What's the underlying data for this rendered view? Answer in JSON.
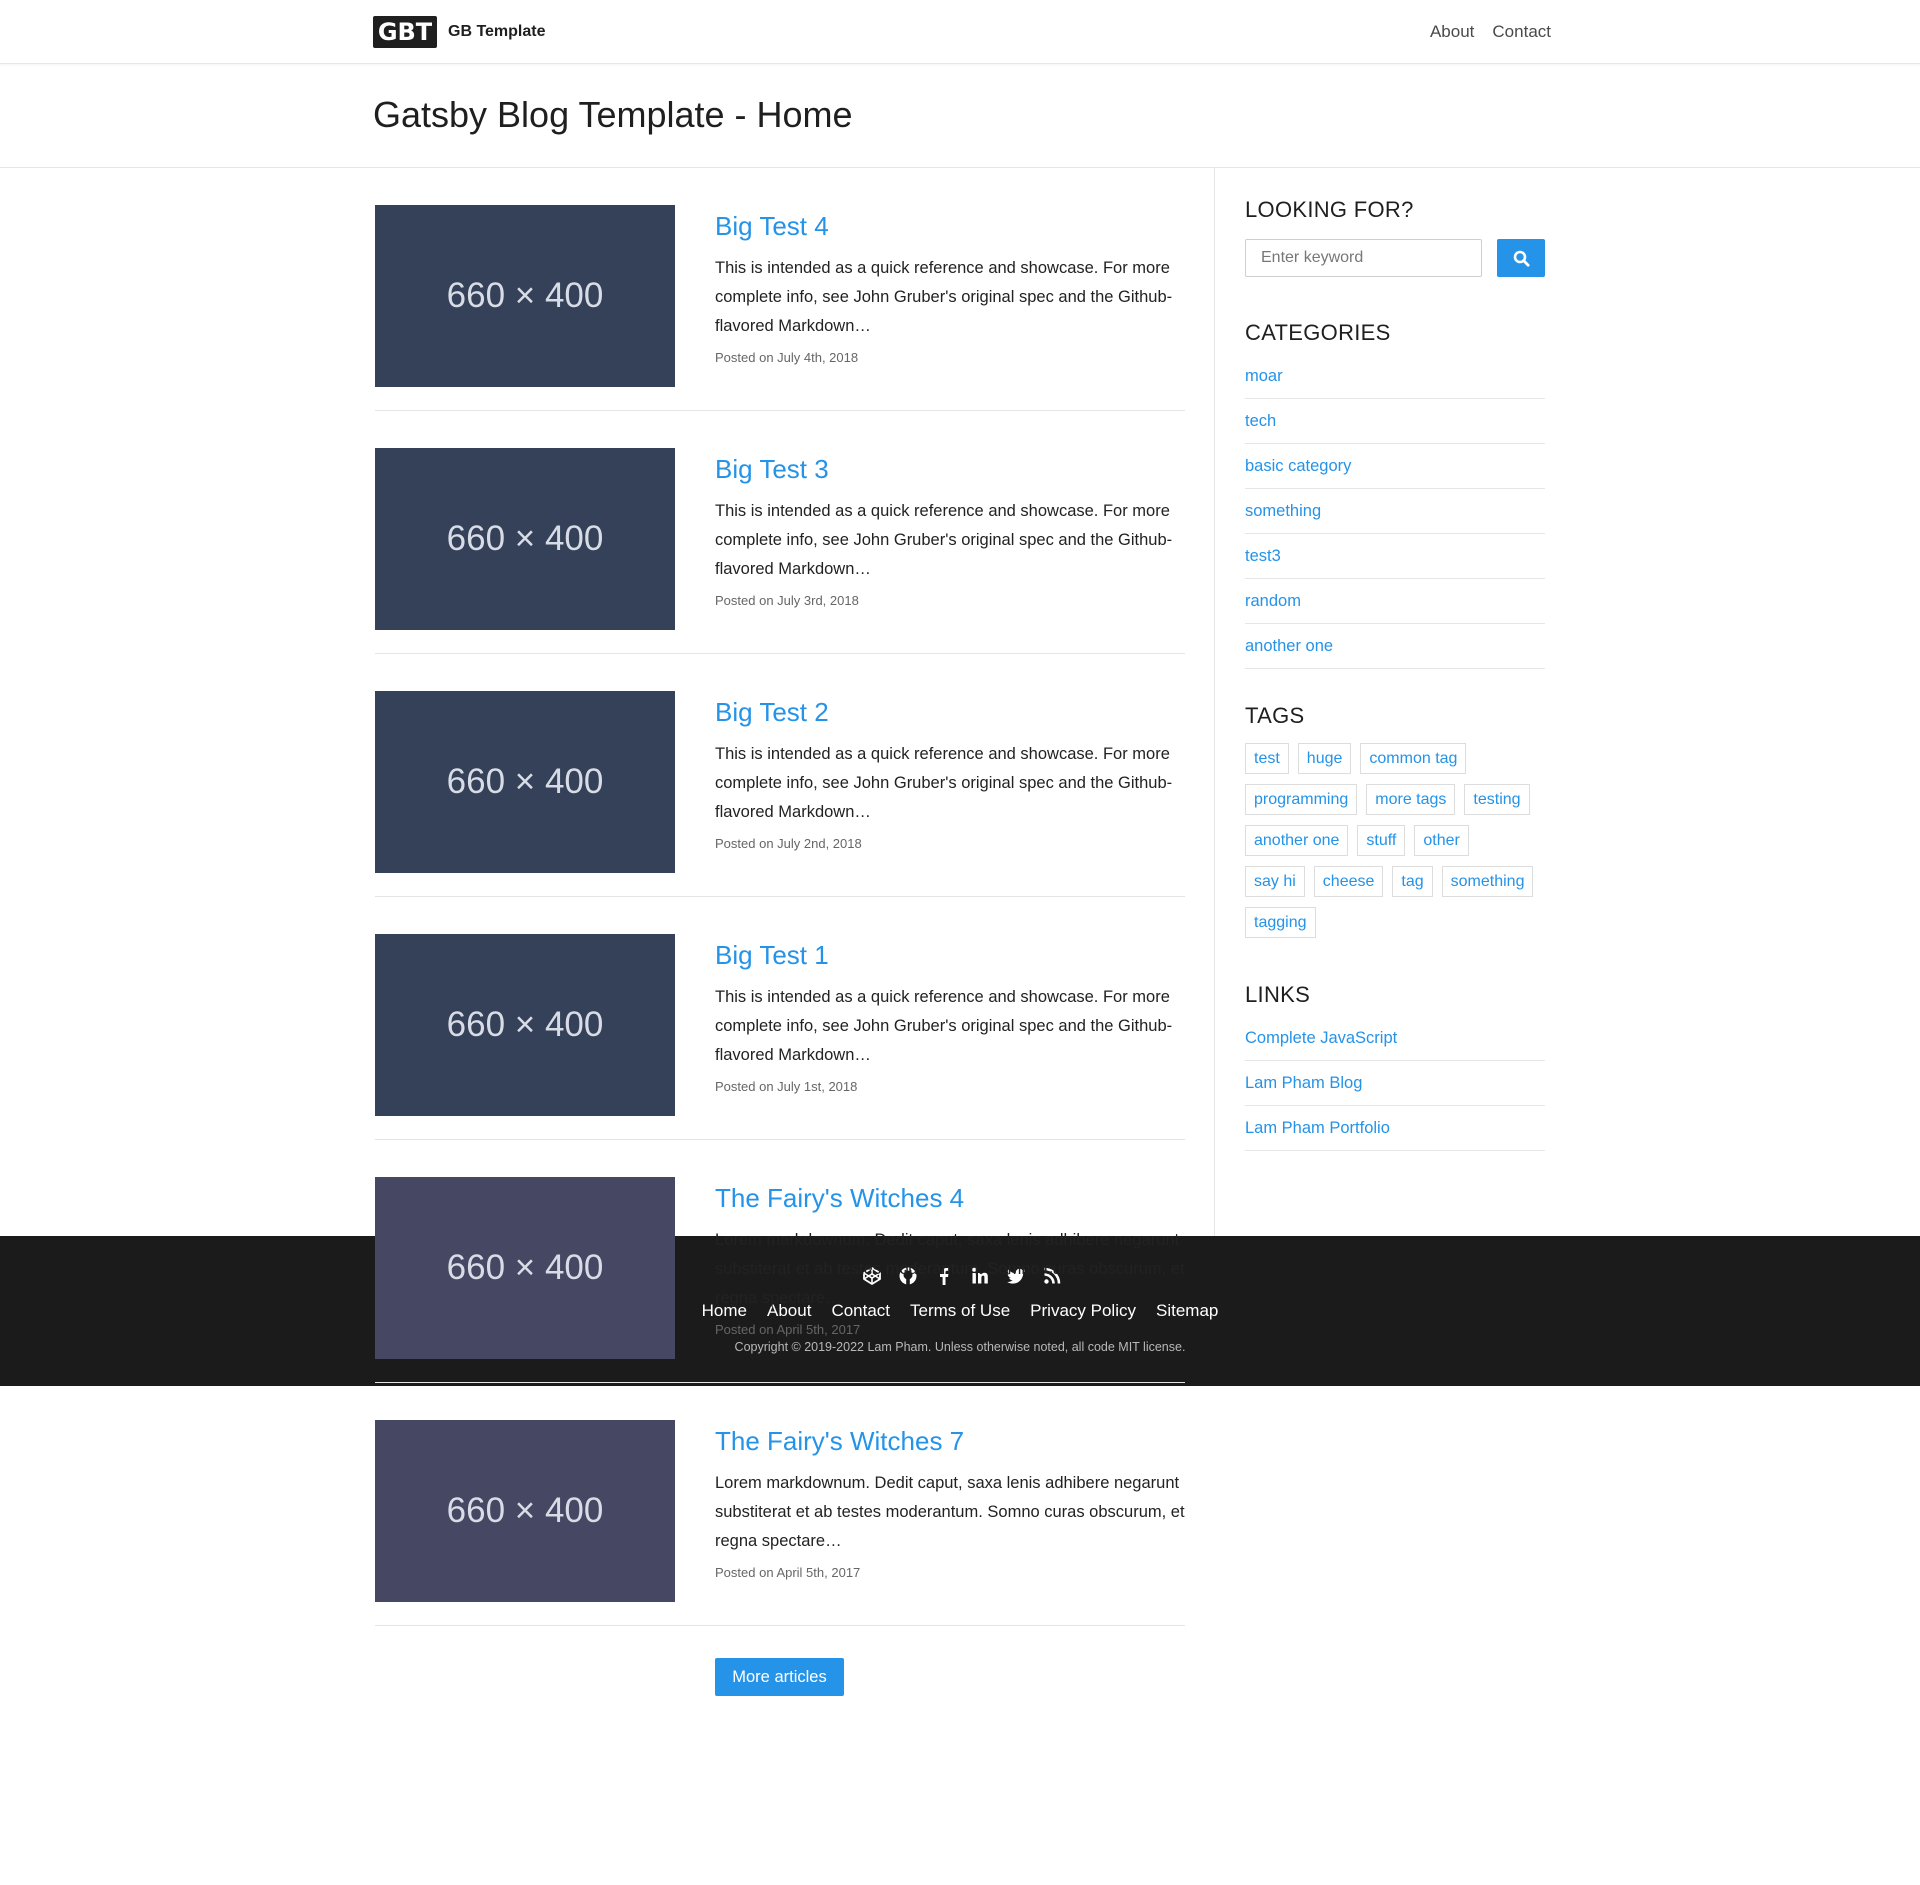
{
  "nav": {
    "logo_text": "GBT",
    "brand": "GB Template",
    "links": [
      "About",
      "Contact"
    ]
  },
  "header": {
    "title": "Gatsby Blog Template - Home"
  },
  "posts": [
    {
      "thumb_label": "660 × 400",
      "thumb_color": "#344158",
      "title": "Big Test 4",
      "excerpt": "This is intended as a quick reference and showcase. For more complete info, see John Gruber's original spec and the Github-flavored Markdown…",
      "date": "Posted on July 4th, 2018"
    },
    {
      "thumb_label": "660 × 400",
      "thumb_color": "#344158",
      "title": "Big Test 3",
      "excerpt": "This is intended as a quick reference and showcase. For more complete info, see John Gruber's original spec and the Github-flavored Markdown…",
      "date": "Posted on July 3rd, 2018"
    },
    {
      "thumb_label": "660 × 400",
      "thumb_color": "#344158",
      "title": "Big Test 2",
      "excerpt": "This is intended as a quick reference and showcase. For more complete info, see John Gruber's original spec and the Github-flavored Markdown…",
      "date": "Posted on July 2nd, 2018"
    },
    {
      "thumb_label": "660 × 400",
      "thumb_color": "#344158",
      "title": "Big Test 1",
      "excerpt": "This is intended as a quick reference and showcase. For more complete info, see John Gruber's original spec and the Github-flavored Markdown…",
      "date": "Posted on July 1st, 2018"
    },
    {
      "thumb_label": "660 × 400",
      "thumb_color": "#464863",
      "title": "The Fairy's Witches 4",
      "excerpt": "Lorem markdownum. Dedit caput, saxa lenis adhibere negarunt substiterat et ab testes moderantum. Somno curas obscurum, et regna spectare…",
      "date": "Posted on April 5th, 2017"
    },
    {
      "thumb_label": "660 × 400",
      "thumb_color": "#464863",
      "title": "The Fairy's Witches 7",
      "excerpt": "Lorem markdownum. Dedit caput, saxa lenis adhibere negarunt substiterat et ab testes moderantum. Somno curas obscurum, et regna spectare…",
      "date": "Posted on April 5th, 2017"
    }
  ],
  "more_button": "More articles",
  "sidebar": {
    "search": {
      "heading": "LOOKING FOR?",
      "placeholder": "Enter keyword",
      "icon": "search-icon"
    },
    "categories": {
      "heading": "CATEGORIES",
      "items": [
        "moar",
        "tech",
        "basic category",
        "something",
        "test3",
        "random",
        "another one"
      ]
    },
    "tags": {
      "heading": "TAGS",
      "items": [
        "test",
        "huge",
        "common tag",
        "programming",
        "more tags",
        "testing",
        "another one",
        "stuff",
        "other",
        "say hi",
        "cheese",
        "tag",
        "something",
        "tagging"
      ]
    },
    "links": {
      "heading": "LINKS",
      "items": [
        "Complete JavaScript",
        "Lam Pham Blog",
        "Lam Pham Portfolio"
      ]
    }
  },
  "footer": {
    "social_icons": [
      "codepen-icon",
      "github-icon",
      "facebook-icon",
      "linkedin-icon",
      "twitter-icon",
      "rss-icon"
    ],
    "links": [
      "Home",
      "About",
      "Contact",
      "Terms of Use",
      "Privacy Policy",
      "Sitemap"
    ],
    "copyright": "Copyright © 2019-2022 Lam Pham. Unless otherwise noted, all code MIT license."
  },
  "colors": {
    "accent": "#2493e8",
    "footer_bg": "#1b1b1b",
    "text": "#1f1f1f"
  }
}
